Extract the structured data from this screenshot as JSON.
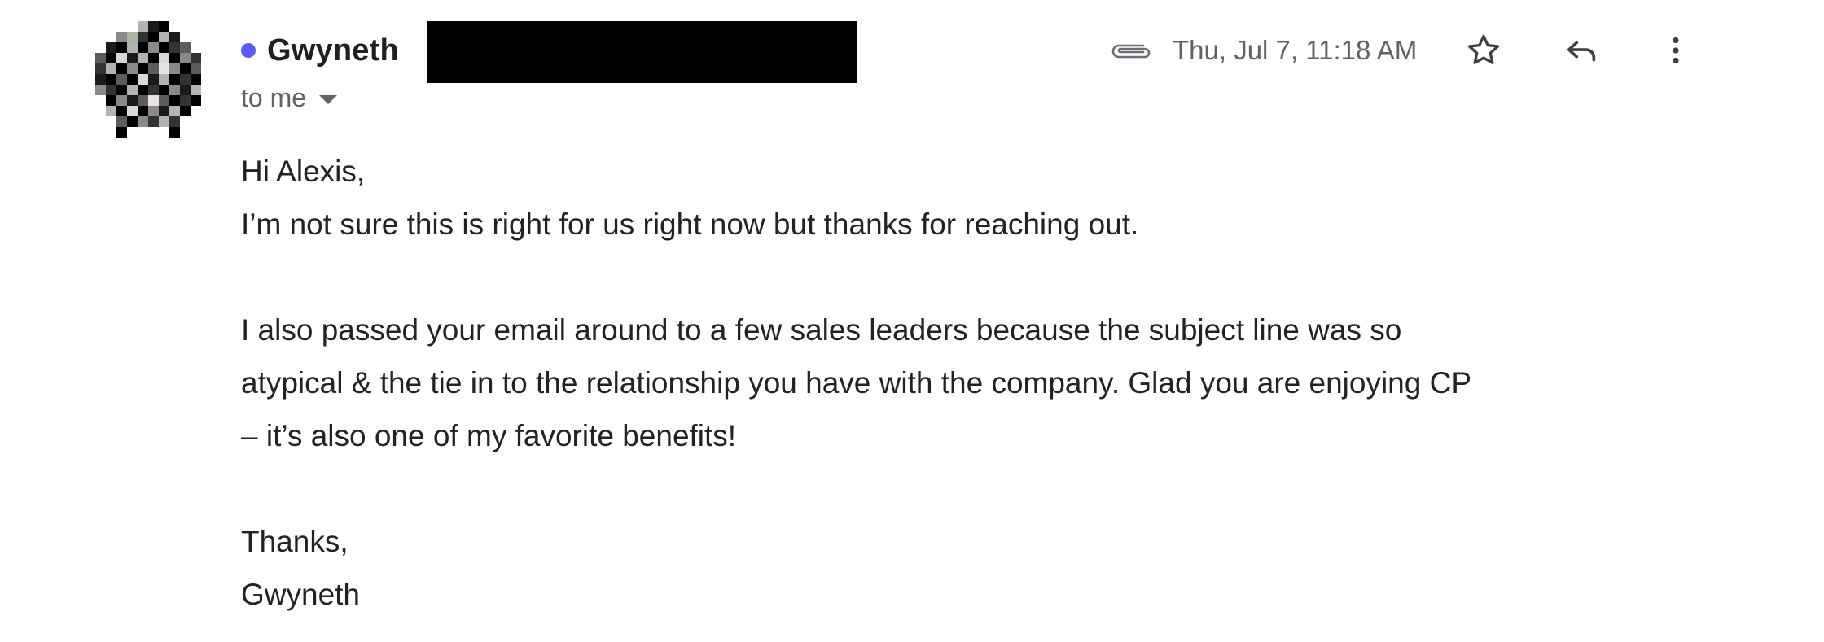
{
  "sender": {
    "name": "Gwyneth",
    "unread_color": "#5b5bf5"
  },
  "recipient": {
    "label": "to me"
  },
  "meta": {
    "has_attachment": true,
    "timestamp": "Thu, Jul 7, 11:18 AM"
  },
  "actions": {
    "star_icon": "star-outline-icon",
    "reply_icon": "reply-icon",
    "more_icon": "more-vertical-icon"
  },
  "message": {
    "greeting": "Hi Alexis,",
    "line1": "I’m not sure this is right for us right now but thanks for reaching out.",
    "para2_line1": "I also passed your email around to a few sales leaders because the subject line was so",
    "para2_line2": "atypical & the tie in to the relationship you have with the company. Glad you are enjoying CP",
    "para2_line3": "– it’s also one of my favorite benefits!",
    "signoff": "Thanks,",
    "signature": "Gwyneth"
  }
}
